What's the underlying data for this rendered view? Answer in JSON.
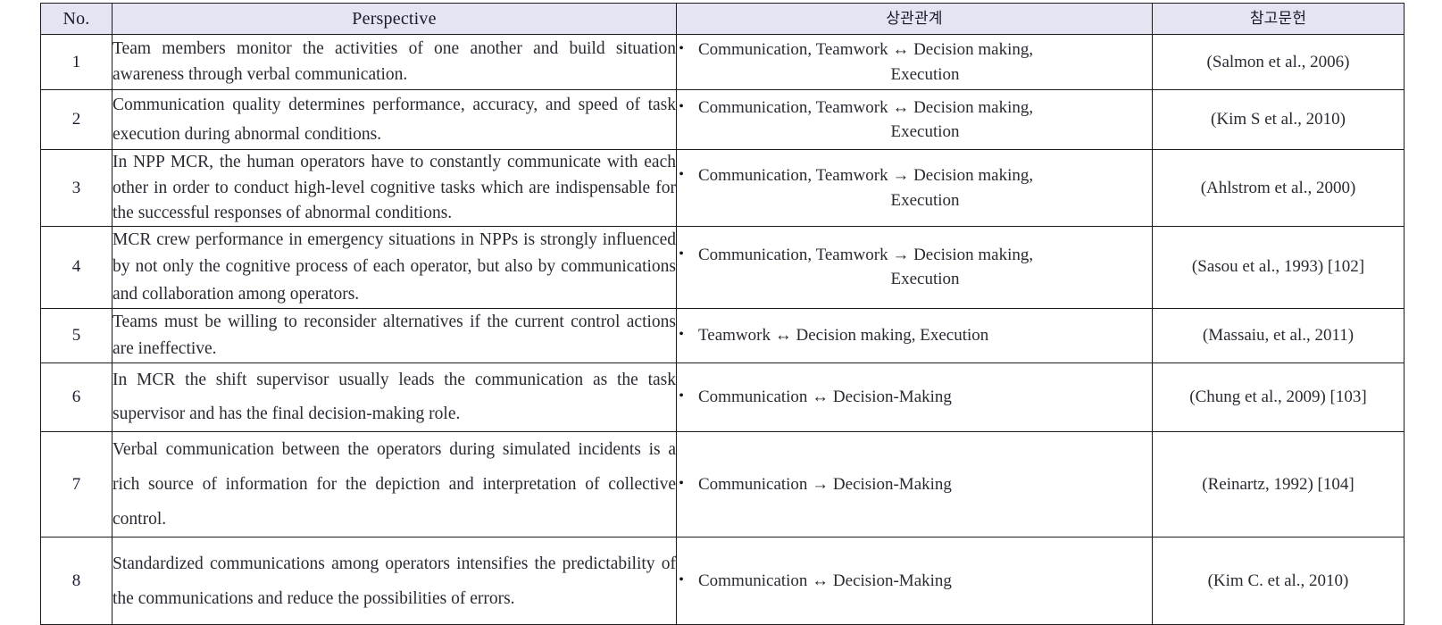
{
  "table": {
    "columns": [
      {
        "key": "no",
        "label": "No."
      },
      {
        "key": "persp",
        "label": "Perspective"
      },
      {
        "key": "rel",
        "label": "상관관계"
      },
      {
        "key": "ref",
        "label": "참고문헌"
      }
    ],
    "header_bg": "#e4e4f2",
    "border_color": "#1b1b1b",
    "text_color": "#2a2a33",
    "bullet_glyph": "•",
    "rows": [
      {
        "no": "1",
        "perspective": "Team members monitor the activities of one another and build situation awareness through verbal communication.",
        "relation_line1": "Communication, Teamwork ↔ Decision making,",
        "relation_line2": "Execution",
        "reference": "(Salmon et al., 2006)"
      },
      {
        "no": "2",
        "perspective": "Communication quality determines performance, accuracy, and speed of task execution during abnormal conditions.",
        "relation_line1": "Communication, Teamwork ↔ Decision making,",
        "relation_line2": "Execution",
        "reference": "(Kim S et al., 2010)"
      },
      {
        "no": "3",
        "perspective": "In NPP MCR, the human operators have to constantly communicate with each other in order to conduct high-level cognitive tasks which are indispensable for the successful responses of abnormal conditions.",
        "relation_line1": "Communication, Teamwork → Decision making,",
        "relation_line2": "Execution",
        "reference": "(Ahlstrom et al., 2000)"
      },
      {
        "no": "4",
        "perspective": "MCR crew performance in emergency situations in NPPs is strongly influenced by not only the cognitive process of each operator, but also by communications and collaboration among operators.",
        "relation_line1": "Communication, Teamwork → Decision making,",
        "relation_line2": "Execution",
        "reference": "(Sasou et al., 1993) [102]"
      },
      {
        "no": "5",
        "perspective": "Teams must be willing to reconsider alternatives if the current control actions are ineffective.",
        "relation_line1": "Teamwork ↔ Decision making, Execution",
        "relation_line2": "",
        "reference": "(Massaiu, et al., 2011)"
      },
      {
        "no": "6",
        "perspective": "In MCR the shift supervisor usually leads the communication as the task supervisor and has the final decision-making role.",
        "relation_line1": "Communication ↔ Decision-Making",
        "relation_line2": "",
        "reference": "(Chung et al., 2009) [103]"
      },
      {
        "no": "7",
        "perspective": "Verbal communication between the operators during simulated incidents is a rich source of information for the depiction and interpretation of collective control.",
        "relation_line1": "Communication → Decision-Making",
        "relation_line2": "",
        "reference": "(Reinartz, 1992) [104]"
      },
      {
        "no": "8",
        "perspective": "Standardized communications among operators intensifies the predictability of the communications and reduce the possibilities of errors.",
        "relation_line1": "Communication ↔ Decision-Making",
        "relation_line2": "",
        "reference": "(Kim C. et al., 2010)"
      }
    ]
  }
}
